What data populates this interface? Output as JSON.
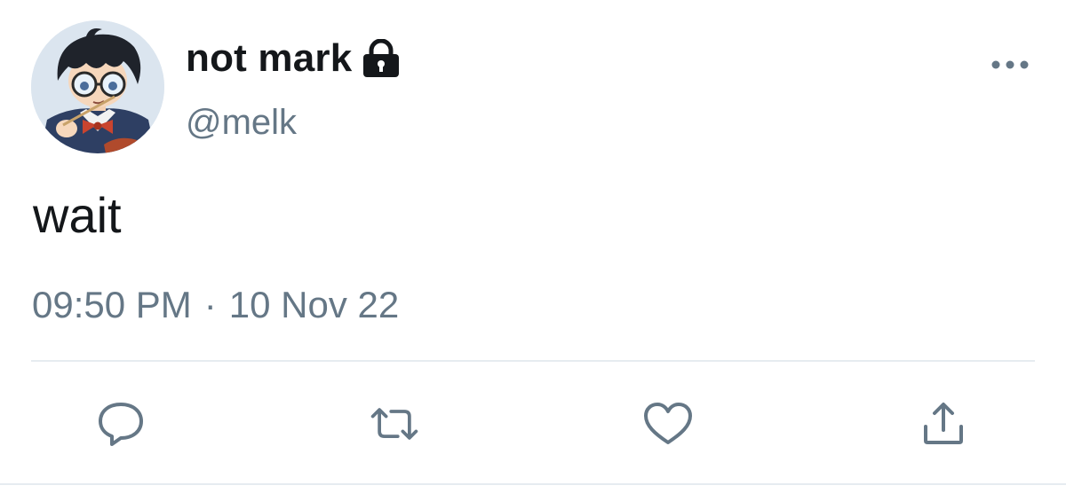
{
  "user": {
    "display_name": "not mark",
    "handle": "@melk",
    "protected": true
  },
  "tweet": {
    "text": "wait",
    "time": "09:50 PM",
    "separator": "·",
    "date": "10 Nov 22"
  },
  "actions": [
    {
      "name": "reply",
      "icon": "speech-bubble-icon"
    },
    {
      "name": "retweet",
      "icon": "retweet-arrows-icon"
    },
    {
      "name": "like",
      "icon": "heart-outline-icon"
    },
    {
      "name": "share",
      "icon": "upload-share-icon"
    }
  ],
  "colors": {
    "text_primary": "#14171a",
    "text_secondary": "#657786",
    "divider": "#e6ecf0",
    "icon": "#657786"
  }
}
